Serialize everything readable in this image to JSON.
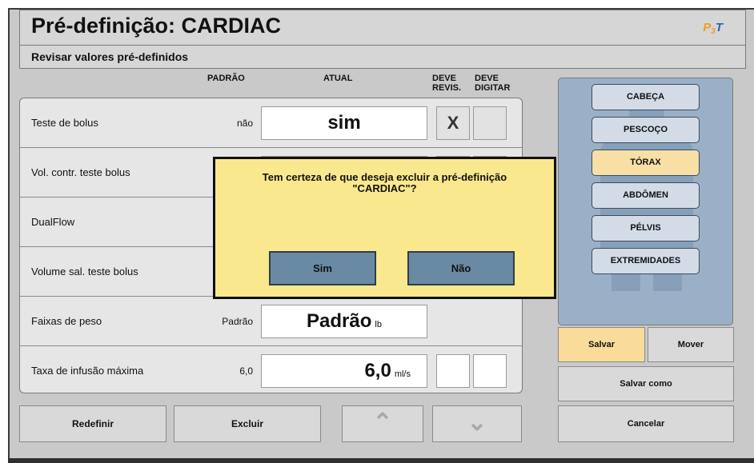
{
  "header": {
    "title": "Pré-definição: CARDIAC",
    "logo": {
      "p": "P",
      "sub": "3",
      "t": "T"
    }
  },
  "subheader": {
    "label": "Revisar valores pré-definidos"
  },
  "columns": {
    "padrao": "PADRÃO",
    "atual": "ATUAL",
    "deve_revis_1": "DEVE",
    "deve_revis_2": "REVIS.",
    "deve_digitar_1": "DEVE",
    "deve_digitar_2": "DIGITAR"
  },
  "rows": [
    {
      "label": "Teste de bolus",
      "default": "não",
      "value": "sim",
      "unit": "",
      "revis": "X",
      "digitar": ""
    },
    {
      "label": "Vol. contr. teste bolus",
      "default": "",
      "value": "",
      "unit": "",
      "revis": "",
      "digitar": ""
    },
    {
      "label": "DualFlow",
      "default": "",
      "value": "",
      "unit": "",
      "revis": "",
      "digitar": ""
    },
    {
      "label": "Volume sal. teste bolus",
      "default": "",
      "value": "",
      "unit": "",
      "revis": "",
      "digitar": ""
    },
    {
      "label": "Faixas de peso",
      "default": "Padrão",
      "value": "Padrão",
      "unit": "lb",
      "revis": "",
      "digitar": ""
    },
    {
      "label": "Taxa de infusão máxima",
      "default": "6,0",
      "value": "6,0",
      "unit": "ml/s",
      "revis": "",
      "digitar": ""
    }
  ],
  "bottom_buttons": {
    "redefinir": "Redefinir",
    "excluir": "Excluir",
    "up": "⌃",
    "down": "⌄"
  },
  "body_regions": [
    "CABEÇA",
    "PESCOÇO",
    "TÓRAX",
    "ABDÔMEN",
    "PÉLVIS",
    "EXTREMIDADES"
  ],
  "side_buttons": {
    "salvar": "Salvar",
    "mover": "Mover",
    "salvar_como": "Salvar como",
    "cancelar": "Cancelar"
  },
  "dialog": {
    "message_1": "Tem certeza de que deseja excluir a pré-definição",
    "message_2": "\"CARDIAC\"?",
    "yes": "Sim",
    "no": "Não"
  },
  "colors": {
    "dialog_bg": "#fae88e",
    "dialog_button": "#6a8aa3",
    "active_region": "#f7dfa6",
    "anatomy_panel": "#9ab0c6",
    "save_button": "#fadc9a",
    "logo_p": "#e8a020",
    "logo_t": "#2a63b8"
  }
}
